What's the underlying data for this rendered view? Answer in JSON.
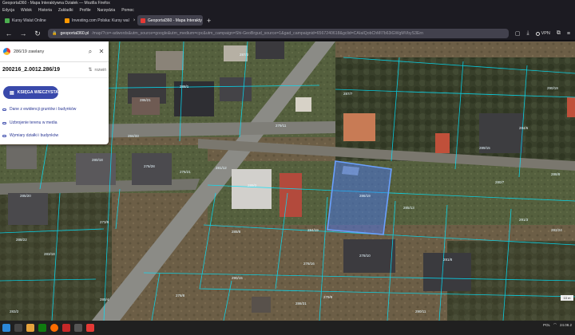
{
  "window": {
    "title": "Geoportal360 - Mapa Interaktywna Działek — Mozilla Firefox"
  },
  "menu": [
    "Edycja",
    "Widok",
    "Historia",
    "Zakładki",
    "Profile",
    "Narzędzia",
    "Pomoc"
  ],
  "tabs": [
    {
      "label": "Kursy Walut Online",
      "active": false,
      "color": "#4caf50"
    },
    {
      "label": "Investing.com Polska: Kursy wal",
      "active": false,
      "color": "#ff9800"
    },
    {
      "label": "Geoportal360 - Mapa Interakty",
      "active": true,
      "color": "#e53935"
    }
  ],
  "url": {
    "domain": "geoportal360.pl",
    "rest": "/map/?cs=-adwords&utm_source=google&utm_medium=cpc&utm_campaign=Shi-GeoBrgud_source=1&gad_campaignid=6567240618&gclid=CAIaIQobChMI7b63iGWgMVbyS3Ern"
  },
  "vpn_label": "VPN",
  "panel": {
    "search": "286/19 zawlany",
    "parcel_id": "200216_2.0012.286/19",
    "expand_label": "rozwiń",
    "kw_button": "KSIĘGA WIECZYSTA",
    "links": [
      "Dane z ewidencji gruntów i budynków",
      "Uzbrojenie terenu w media",
      "Wymiary działki i budynków"
    ]
  },
  "map": {
    "parcel_labels": [
      "286/19",
      "287/2",
      "288/1",
      "286/21",
      "280/18",
      "276/28",
      "287/7",
      "279/11",
      "289/15",
      "281/12",
      "276/21",
      "289/3",
      "285/13",
      "278/10",
      "281/8",
      "284/19",
      "279/9",
      "290/11",
      "276/8",
      "280/4",
      "285/20",
      "288/22",
      "283/18",
      "273/9",
      "290/19",
      "284/6",
      "288/8",
      "282/24",
      "291/3",
      "280/7",
      "276/16",
      "286/31",
      "285/8",
      "290/15",
      "287/25",
      "283/2",
      "284/33",
      "286/11"
    ],
    "selected_parcel_color": "#4a7bff"
  },
  "scale_label": "10 m",
  "tray": {
    "time": "24.08.2",
    "lang": "POL"
  },
  "colors": {
    "accent": "#3949ab",
    "parcel_line": "#00e5ff"
  }
}
